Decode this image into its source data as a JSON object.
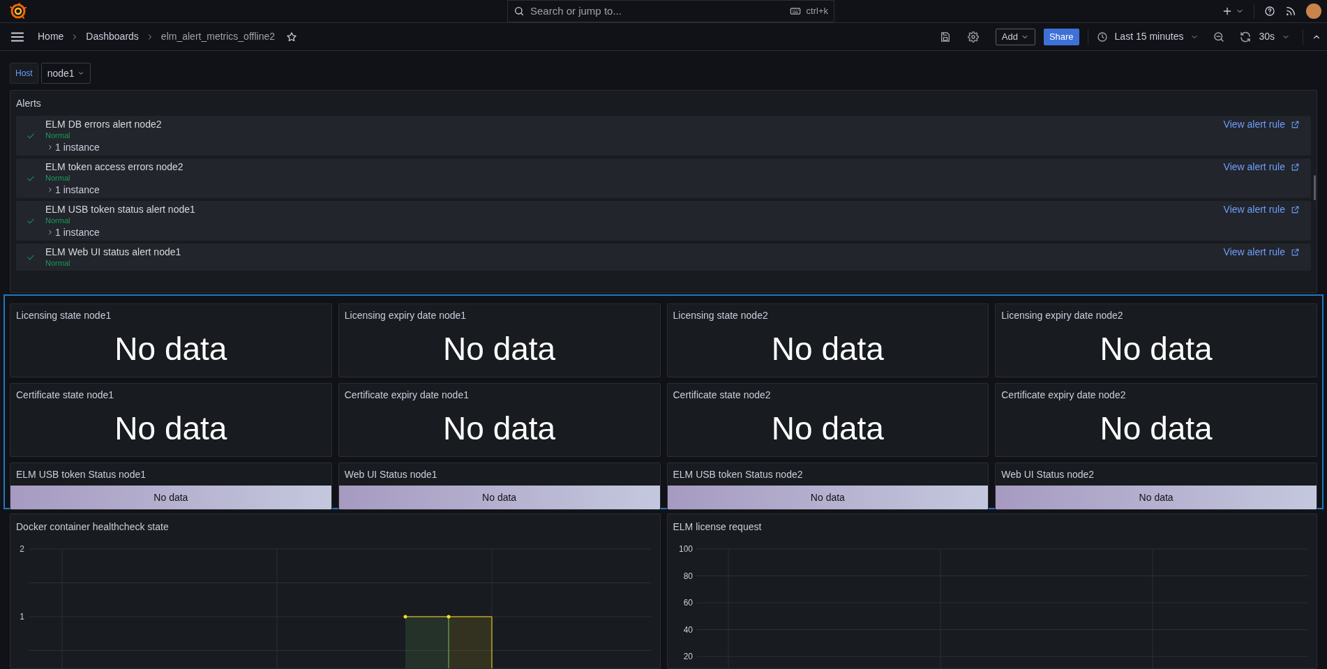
{
  "topbar": {
    "search": {
      "placeholder": "Search or jump to...",
      "shortcut": "ctrl+k"
    }
  },
  "breadcrumbs": [
    {
      "label": "Home",
      "current": false
    },
    {
      "label": "Dashboards",
      "current": false
    },
    {
      "label": "elm_alert_metrics_offline2",
      "current": true
    }
  ],
  "toolbar": {
    "add_label": "Add",
    "share_label": "Share",
    "time_range": "Last 15 minutes",
    "refresh": "30s"
  },
  "variables": [
    {
      "label": "Host",
      "value": "node1"
    }
  ],
  "alerts": {
    "title": "Alerts",
    "items": [
      {
        "name": "ELM DB errors alert node2",
        "state": "Normal",
        "instances": "1 instance",
        "link_label": "View alert rule"
      },
      {
        "name": "ELM token access errors node2",
        "state": "Normal",
        "instances": "1 instance",
        "link_label": "View alert rule"
      },
      {
        "name": "ELM USB token status alert node1",
        "state": "Normal",
        "instances": "1 instance",
        "link_label": "View alert rule"
      },
      {
        "name": "ELM Web UI status alert node1",
        "state": "Normal",
        "link_label": "View alert rule"
      }
    ]
  },
  "stats": [
    {
      "title": "Licensing state node1",
      "value": "No data",
      "kind": "big"
    },
    {
      "title": "Licensing expiry date node1",
      "value": "No data",
      "kind": "big"
    },
    {
      "title": "Licensing state node2",
      "value": "No data",
      "kind": "big"
    },
    {
      "title": "Licensing expiry date node2",
      "value": "No data",
      "kind": "big"
    },
    {
      "title": "Certificate state node1",
      "value": "No data",
      "kind": "big"
    },
    {
      "title": "Certificate expiry date node1",
      "value": "No data",
      "kind": "big"
    },
    {
      "title": "Certificate state node2",
      "value": "No data",
      "kind": "big"
    },
    {
      "title": "Certificate expiry date node2",
      "value": "No data",
      "kind": "big"
    },
    {
      "title": "ELM USB token Status node1",
      "value": "No data",
      "kind": "bar"
    },
    {
      "title": "Web UI Status node1",
      "value": "No data",
      "kind": "bar"
    },
    {
      "title": "ELM USB token Status node2",
      "value": "No data",
      "kind": "bar"
    },
    {
      "title": "Web UI Status node2",
      "value": "No data",
      "kind": "bar"
    }
  ],
  "charts": [
    {
      "title": "Docker container healthcheck state",
      "kind": "step",
      "y_axis_labels": [
        "2",
        "1"
      ]
    },
    {
      "title": "ELM license request",
      "kind": "empty",
      "y_axis_labels": [
        "100",
        "80",
        "60",
        "40",
        "20"
      ]
    }
  ]
}
